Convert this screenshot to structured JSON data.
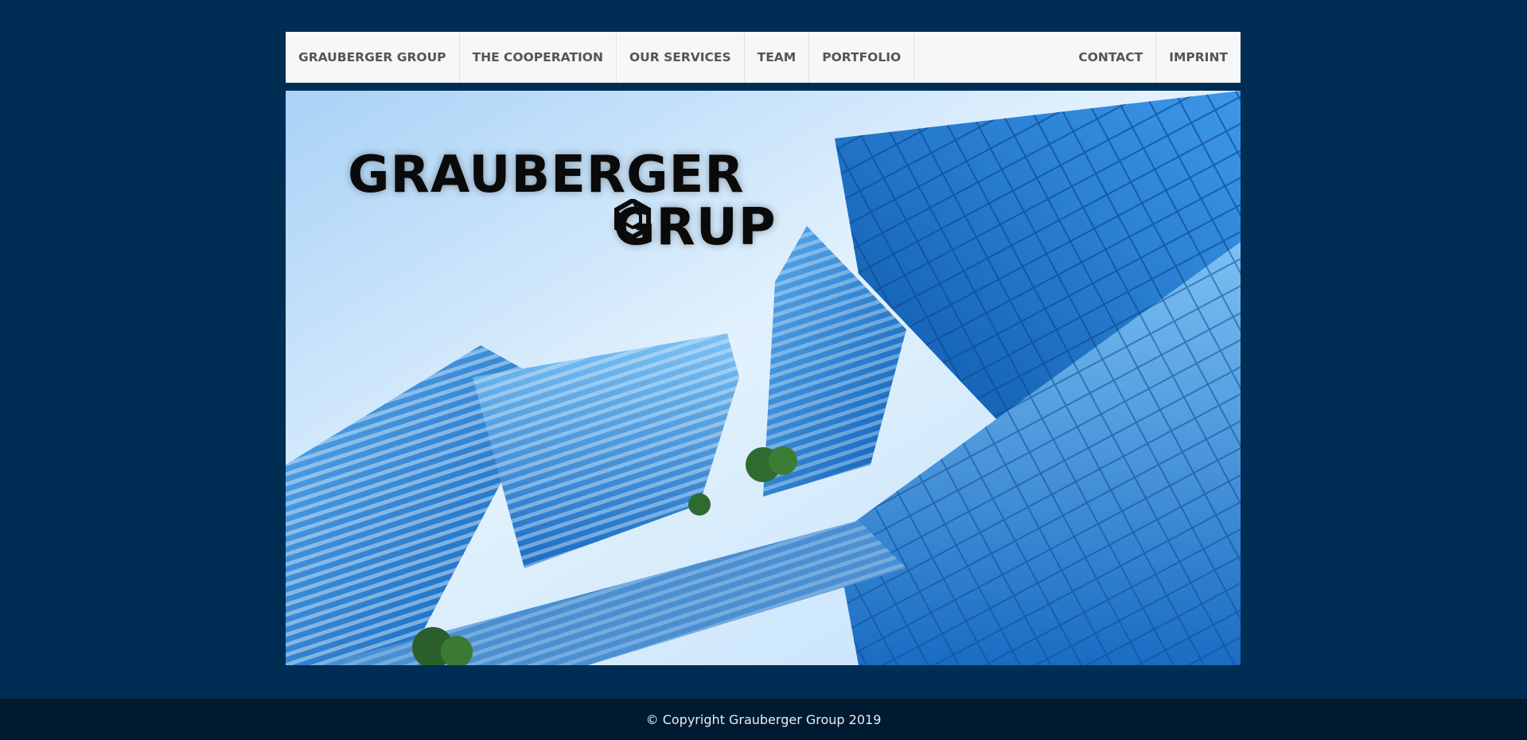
{
  "nav": {
    "left": [
      {
        "label": "GRAUBERGER GROUP"
      },
      {
        "label": "THE COOPERATION"
      },
      {
        "label": "OUR SERVICES"
      },
      {
        "label": "TEAM"
      },
      {
        "label": "PORTFOLIO"
      }
    ],
    "right": [
      {
        "label": "CONTACT"
      },
      {
        "label": "IMPRINT"
      }
    ]
  },
  "hero": {
    "logo_line1": "GRAUBERGER",
    "logo_line2_pre": "GR",
    "logo_line2_post": "UP"
  },
  "footer": {
    "copyright": "© Copyright Grauberger Group 2019"
  },
  "colors": {
    "background": "#002d54",
    "navbar": "#f7f7f7",
    "nav_text": "#555555",
    "footer_bg": "#001a31"
  }
}
